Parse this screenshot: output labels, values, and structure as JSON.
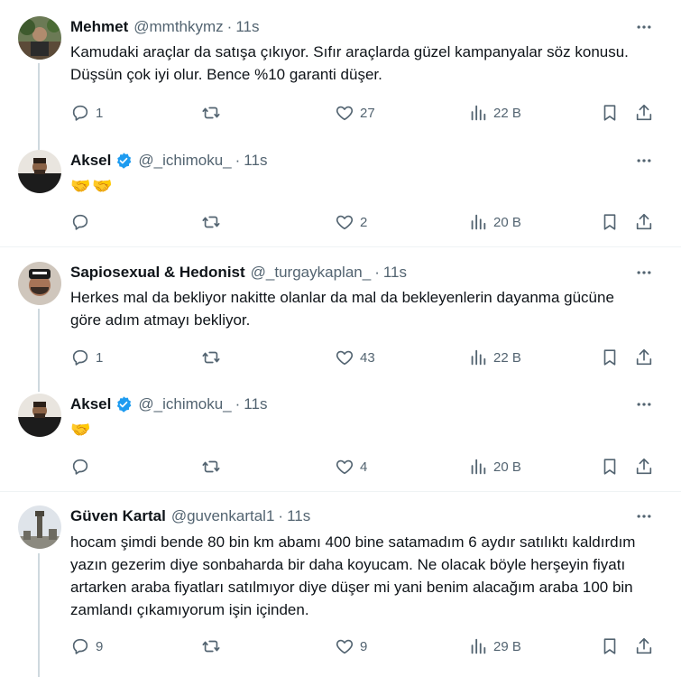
{
  "tweets": [
    {
      "name": "Mehmet",
      "handle": "@mmthkymz",
      "time": "11s",
      "verified": false,
      "text": "Kamudaki araçlar da satışa çıkıyor. Sıfır araçlarda güzel kampanyalar söz konusu. Düşsün çok iyi olur. Bence %10 garanti düşer.",
      "replies": "1",
      "reposts": "",
      "likes": "27",
      "views": "22 B"
    },
    {
      "name": "Aksel",
      "handle": "@_ichimoku_",
      "time": "11s",
      "verified": true,
      "text": "🤝🤝",
      "replies": "",
      "reposts": "",
      "likes": "2",
      "views": "20 B"
    },
    {
      "name": "Sapiosexual & Hedonist",
      "handle": "@_turgaykaplan_",
      "time": "11s",
      "verified": false,
      "text": "Herkes mal da bekliyor nakitte olanlar da mal da bekleyenlerin dayanma gücüne göre adım atmayı bekliyor.",
      "replies": "1",
      "reposts": "",
      "likes": "43",
      "views": "22 B"
    },
    {
      "name": "Aksel",
      "handle": "@_ichimoku_",
      "time": "11s",
      "verified": true,
      "text": "🤝",
      "replies": "",
      "reposts": "",
      "likes": "4",
      "views": "20 B"
    },
    {
      "name": "Güven Kartal",
      "handle": "@guvenkartal1",
      "time": "11s",
      "verified": false,
      "text": "hocam şimdi bende 80 bin km abamı 400 bine satamadım 6 aydır satılıktı kaldırdım yazın  gezerim diye sonbaharda bir daha koyucam. Ne olacak böyle herşeyin fiyatı artarken araba fiyatları satılmıyor diye düşer mi yani benim alacağım araba 100 bin zamlandı çıkamıyorum işin içinden.",
      "replies": "9",
      "reposts": "",
      "likes": "9",
      "views": "29 B"
    }
  ],
  "colors": {
    "text": "#0f1419",
    "muted": "#536471",
    "thread_line": "#cfd9de",
    "verified": "#1d9bf0",
    "divider": "#eff3f4"
  },
  "icons": [
    "more-icon",
    "reply-icon",
    "repost-icon",
    "like-icon",
    "views-icon",
    "bookmark-icon",
    "share-icon",
    "verified-badge-icon"
  ]
}
